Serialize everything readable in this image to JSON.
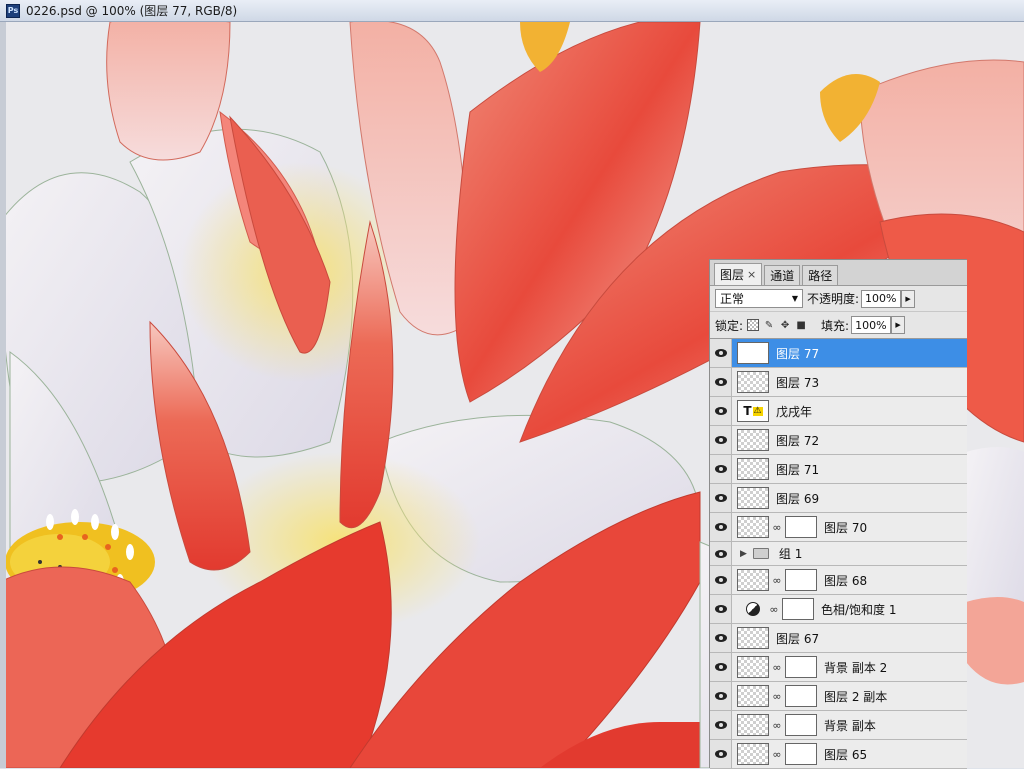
{
  "window": {
    "app_icon": "Ps",
    "title": "0226.psd @ 100% (图层 77, RGB/8)"
  },
  "layers_panel": {
    "tabs": [
      {
        "label": "图层",
        "close": "×",
        "active": true
      },
      {
        "label": "通道",
        "active": false
      },
      {
        "label": "路径",
        "active": false
      }
    ],
    "blend_mode": "正常",
    "opacity_label": "不透明度:",
    "opacity_value": "100%",
    "lock_label": "锁定:",
    "fill_label": "填充:",
    "fill_value": "100%",
    "layers": [
      {
        "name": "图层 77",
        "type": "pixel",
        "selected": true,
        "visible": true
      },
      {
        "name": "图层 73",
        "type": "pixel",
        "visible": true
      },
      {
        "name": "戊戌年",
        "type": "text",
        "thumb_label": "T",
        "visible": true
      },
      {
        "name": "图层 72",
        "type": "pixel",
        "visible": true
      },
      {
        "name": "图层 71",
        "type": "pixel",
        "visible": true
      },
      {
        "name": "图层 69",
        "type": "pixel",
        "visible": true
      },
      {
        "name": "图层 70",
        "type": "masked",
        "visible": true
      },
      {
        "name": "组 1",
        "type": "group",
        "visible": true
      },
      {
        "name": "图层 68",
        "type": "masked",
        "visible": true
      },
      {
        "name": "色相/饱和度 1",
        "type": "adjustment",
        "visible": true
      },
      {
        "name": "图层 67",
        "type": "pixel",
        "visible": true
      },
      {
        "name": "背景 副本 2",
        "type": "masked",
        "visible": true
      },
      {
        "name": "图层 2 副本",
        "type": "masked",
        "visible": true
      },
      {
        "name": "背景 副本",
        "type": "masked",
        "visible": true
      },
      {
        "name": "图层 65",
        "type": "masked",
        "visible": true
      }
    ]
  },
  "colors": {
    "selection": "#3d8ee6",
    "petal_red": "#e8453a",
    "petal_pink": "#f2a69a",
    "petal_white": "#eeeaf0",
    "stamen_yellow": "#f0c020"
  }
}
